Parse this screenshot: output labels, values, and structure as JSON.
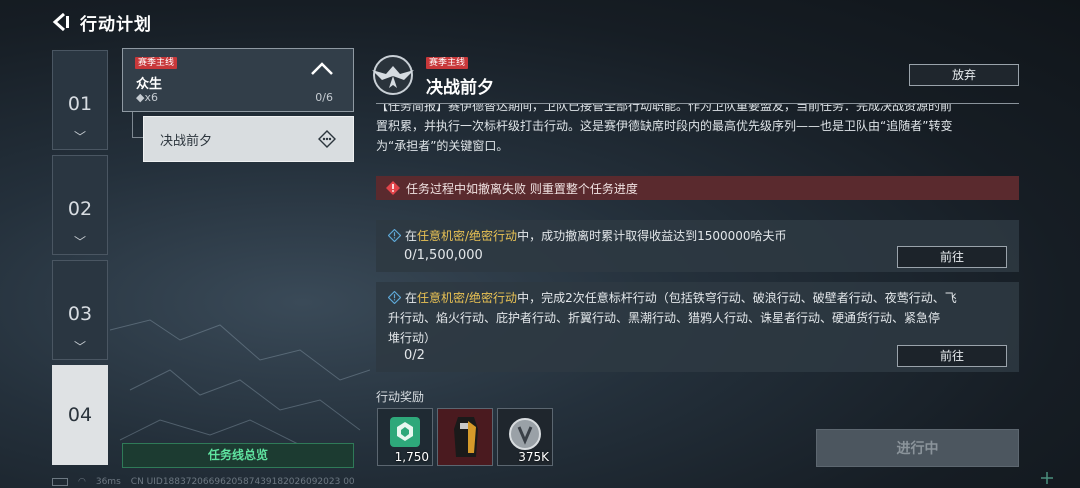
{
  "header": {
    "title": "行动计划",
    "back_icon": "back-arrow-icon"
  },
  "chapters": [
    {
      "label": "01",
      "active": false
    },
    {
      "label": "02",
      "active": false
    },
    {
      "label": "03",
      "active": false
    },
    {
      "label": "04",
      "active": true
    }
  ],
  "mission": {
    "tag": "赛季主线",
    "name": "众生",
    "reward": "◆x6",
    "progress": "0/6"
  },
  "sub_mission": {
    "name": "决战前夕"
  },
  "overview_button": "任务线总览",
  "detail": {
    "tag": "赛季主线",
    "title": "决战前夕",
    "abandon_label": "放弃",
    "description_line1": "【任务简报】赛伊德替达期间，卫队已接管全部行动职能。作为卫队重要盟友，当前任务：完成决战资源的前",
    "description_line2": "置积累，并执行一次标杆级打击行动。这是赛伊德缺席时段内的最高优先级序列——也是卫队由“追随者”转变",
    "description_line3": "为“承担者”的关键窗口。",
    "warning": "任务过程中如撤离失败 则重置整个任务进度"
  },
  "objectives": [
    {
      "prefix": "在",
      "highlight": "任意机密/绝密行动",
      "text": "中，成功撤离时累计取得收益达到1500000哈夫币",
      "progress": "0/1,500,000",
      "button": "前往"
    },
    {
      "prefix": "在",
      "highlight": "任意机密/绝密行动",
      "text_line1": "中，完成2次任意标杆行动（包括铁穹行动、破浪行动、破壁者行动、夜莺行动、飞",
      "text_line2": "升行动、焰火行动、庇护者行动、折翼行动、黑潮行动、猎鸦人行动、诛星者行动、硬通货行动、紧急停",
      "text_line3": "堆行动）",
      "progress": "0/2",
      "button": "前往"
    }
  ],
  "rewards": {
    "label": "行动奖励",
    "items": [
      {
        "icon": "green-badge-icon",
        "amount": "1,750"
      },
      {
        "icon": "outfit-icon",
        "amount": ""
      },
      {
        "icon": "coin-icon",
        "amount": "375K"
      }
    ]
  },
  "start_button": "进行中",
  "status": {
    "ping": "36ms",
    "uid": "CN UID1883720669620587439182026092023 00"
  },
  "colors": {
    "accent_green": "#5fe3a0",
    "tag_red": "#c8383a",
    "highlight": "#e9c254",
    "warning_bg": "#5a2a2e"
  }
}
